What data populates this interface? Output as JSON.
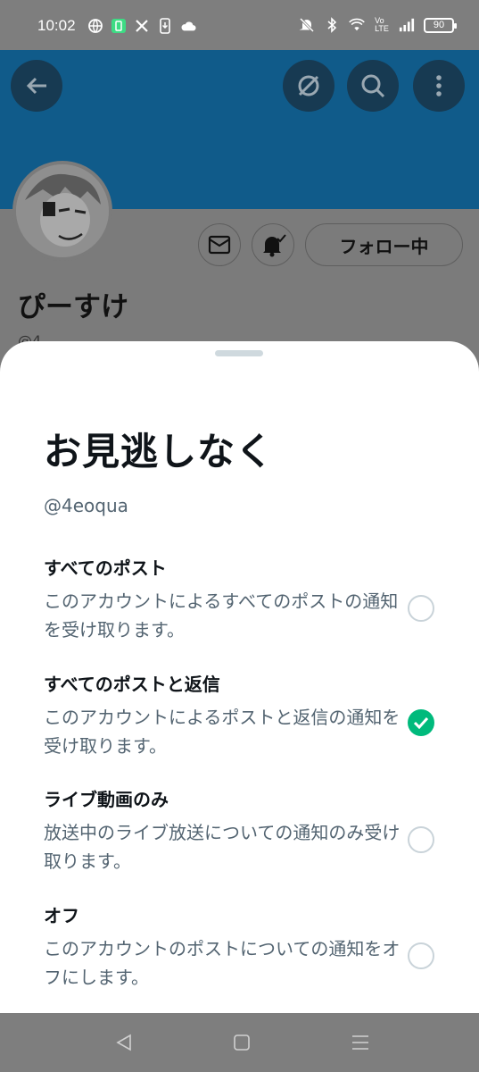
{
  "status_bar": {
    "time": "10:02",
    "battery": "90",
    "left_icons": [
      "globe-icon",
      "app-icon",
      "x-icon",
      "download-icon",
      "cloud-icon"
    ],
    "right_icons": [
      "mute-icon",
      "bluetooth-icon",
      "wifi-icon",
      "volte-icon",
      "signal-icon"
    ]
  },
  "profile": {
    "name": "ぴーすけ",
    "handle_partial": "@4",
    "follow_label": "フォロー中",
    "banner_color": "#105b8a"
  },
  "sheet": {
    "title": "お見逃しなく",
    "handle": "@4eoqua",
    "options": [
      {
        "title": "すべてのポスト",
        "desc": "このアカウントによるすべてのポストの通知を受け取ります。",
        "checked": false
      },
      {
        "title": "すべてのポストと返信",
        "desc": "このアカウントによるポストと返信の通知を受け取ります。",
        "checked": true
      },
      {
        "title": "ライブ動画のみ",
        "desc": "放送中のライブ放送についての通知のみ受け取ります。",
        "checked": false
      },
      {
        "title": "オフ",
        "desc": "このアカウントのポストについての通知をオフにします。",
        "checked": false
      }
    ],
    "accent": "#00ba7c"
  },
  "nav": {
    "icons": [
      "back-nav-icon",
      "home-nav-icon",
      "recents-nav-icon"
    ]
  }
}
